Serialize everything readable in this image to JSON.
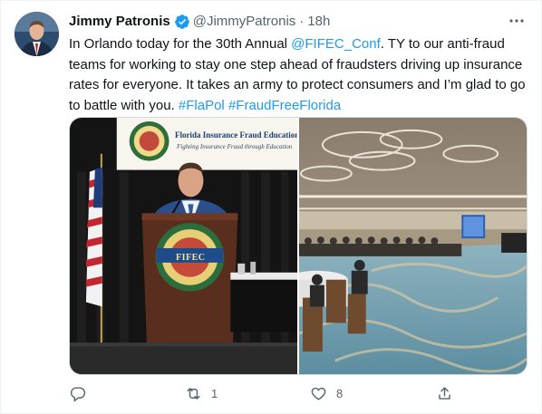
{
  "author": {
    "name": "Jimmy Patronis",
    "handle": "@JimmyPatronis",
    "separator": "·",
    "time": "18h",
    "verified_icon": "verified-badge-icon",
    "accent_color": "#1d9bf0"
  },
  "tweet": {
    "line1_a": "In Orlando today for the 30th Annual ",
    "mention": "@FIFEC_Conf",
    "line1_b": ". TY to our anti-fraud",
    "line2": "teams for working to stay one step ahead of fraudsters driving up insurance",
    "line3": "rates for everyone. It takes an army to protect consumers and I’m glad to go",
    "line4": "to battle with you. ",
    "hashtag1": "#FlaPol",
    "hashtag2": "#FraudFreeFlorida"
  },
  "media": {
    "photo1_banner_title": "Florida Insurance Fraud Education",
    "photo1_banner_subtitle": "Fighting Insurance Fraud through Education",
    "photo1_logo_text": "FIFEC"
  },
  "actions": {
    "reply_icon": "reply-icon",
    "retweet_icon": "retweet-icon",
    "retweet_count": "1",
    "like_icon": "heart-icon",
    "like_count": "8",
    "share_icon": "share-icon"
  },
  "menu_icon": "more-options-icon"
}
